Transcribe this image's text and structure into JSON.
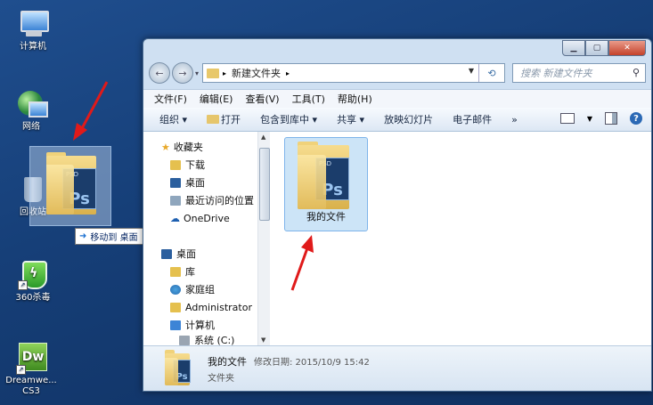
{
  "desktop": {
    "icons": [
      {
        "label": "计算机"
      },
      {
        "label": "网络"
      },
      {
        "label": "回收站"
      },
      {
        "label": "360杀毒"
      },
      {
        "label": "Dreamwe...",
        "label2": "CS3"
      }
    ],
    "drag_tooltip": "移动到 桌面"
  },
  "window": {
    "breadcrumb": "新建文件夹",
    "search_placeholder": "搜索 新建文件夹",
    "menu": [
      "文件(F)",
      "编辑(E)",
      "查看(V)",
      "工具(T)",
      "帮助(H)"
    ],
    "toolbar": [
      "组织 ▾",
      "打开",
      "包含到库中 ▾",
      "共享 ▾",
      "放映幻灯片",
      "电子邮件",
      "»"
    ],
    "nav": {
      "favorites_header": "收藏夹",
      "favorites": [
        "下载",
        "桌面",
        "最近访问的位置",
        "OneDrive"
      ],
      "desktop_header": "桌面",
      "desktop_items": [
        "库",
        "家庭组",
        "Administrator",
        "计算机",
        "系统 (C:)"
      ]
    },
    "files": [
      {
        "name": "我的文件"
      }
    ],
    "details": {
      "name": "我的文件",
      "modified": "修改日期: 2015/10/9 15:42",
      "type": "文件夹"
    }
  },
  "colors": {
    "accent": "#2b69b5",
    "arrow": "#e01a1a",
    "selection": "#cce4f7"
  }
}
